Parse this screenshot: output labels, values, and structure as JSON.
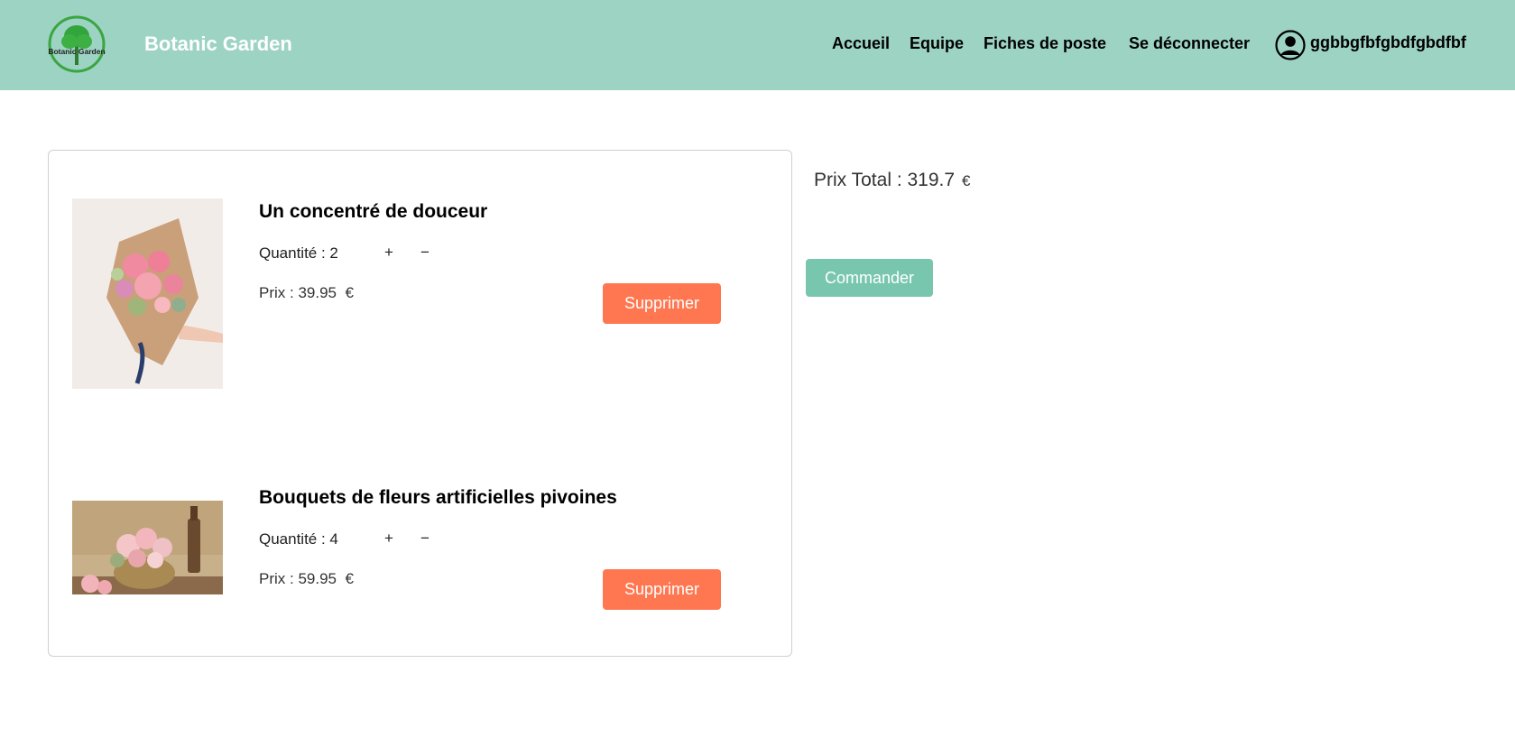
{
  "header": {
    "brand": "Botanic Garden",
    "logo_text": "Botanic Garden",
    "nav": [
      "Accueil",
      "Equipe",
      "Fiches de poste",
      "Se déconnecter"
    ],
    "username": "ggbbgfbfgbdfgbdfbf",
    "user_icon": "user-circle-icon",
    "background_color": "#9dd3c3"
  },
  "cart": {
    "items": [
      {
        "title": "Un concentré de douceur",
        "quantity_label": "Quantité : 2",
        "plus": "+",
        "minus": "−",
        "price_label": "Prix : 39.95",
        "currency": "€",
        "delete_label": "Supprimer"
      },
      {
        "title": "Bouquets de fleurs artificielles pivoines",
        "quantity_label": "Quantité : 4",
        "plus": "+",
        "minus": "−",
        "price_label": "Prix : 59.95",
        "currency": "€",
        "delete_label": "Supprimer"
      }
    ]
  },
  "summary": {
    "total_label": "Prix Total : 319.7",
    "currency": "€",
    "order_label": "Commander"
  },
  "colors": {
    "accent": "#79c6ae",
    "delete": "#ff7751"
  }
}
